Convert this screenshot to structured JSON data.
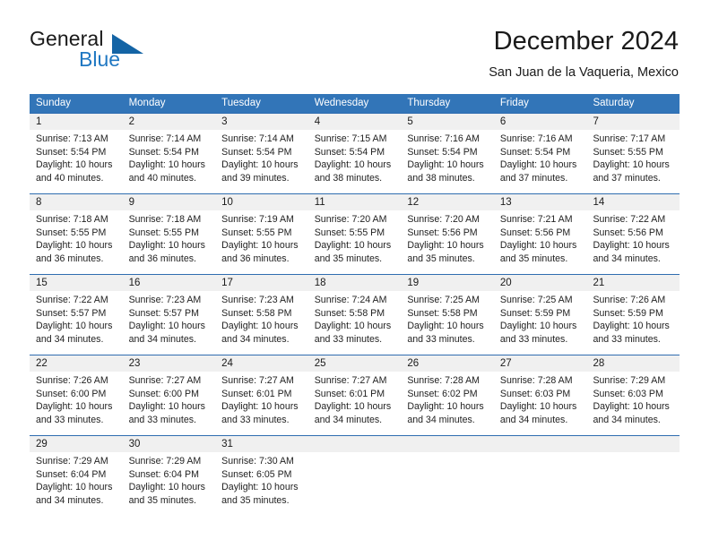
{
  "logo": {
    "word_one": "General",
    "word_two": "Blue",
    "triangle_icon": "blue-triangle-icon",
    "accent_color": "#1464a5",
    "blue_text_color": "#1f77c2"
  },
  "header": {
    "title": "December 2024",
    "subtitle": "San Juan de la Vaqueria, Mexico"
  },
  "theme": {
    "header_band_color": "#3275b8",
    "week_divider_color": "#2f6db0",
    "day_band_color": "#f0f0f0"
  },
  "weekdays": [
    "Sunday",
    "Monday",
    "Tuesday",
    "Wednesday",
    "Thursday",
    "Friday",
    "Saturday"
  ],
  "weeks": [
    [
      {
        "day": "1",
        "sunrise": "Sunrise: 7:13 AM",
        "sunset": "Sunset: 5:54 PM",
        "daylight_line1": "Daylight: 10 hours",
        "daylight_line2": "and 40 minutes."
      },
      {
        "day": "2",
        "sunrise": "Sunrise: 7:14 AM",
        "sunset": "Sunset: 5:54 PM",
        "daylight_line1": "Daylight: 10 hours",
        "daylight_line2": "and 40 minutes."
      },
      {
        "day": "3",
        "sunrise": "Sunrise: 7:14 AM",
        "sunset": "Sunset: 5:54 PM",
        "daylight_line1": "Daylight: 10 hours",
        "daylight_line2": "and 39 minutes."
      },
      {
        "day": "4",
        "sunrise": "Sunrise: 7:15 AM",
        "sunset": "Sunset: 5:54 PM",
        "daylight_line1": "Daylight: 10 hours",
        "daylight_line2": "and 38 minutes."
      },
      {
        "day": "5",
        "sunrise": "Sunrise: 7:16 AM",
        "sunset": "Sunset: 5:54 PM",
        "daylight_line1": "Daylight: 10 hours",
        "daylight_line2": "and 38 minutes."
      },
      {
        "day": "6",
        "sunrise": "Sunrise: 7:16 AM",
        "sunset": "Sunset: 5:54 PM",
        "daylight_line1": "Daylight: 10 hours",
        "daylight_line2": "and 37 minutes."
      },
      {
        "day": "7",
        "sunrise": "Sunrise: 7:17 AM",
        "sunset": "Sunset: 5:55 PM",
        "daylight_line1": "Daylight: 10 hours",
        "daylight_line2": "and 37 minutes."
      }
    ],
    [
      {
        "day": "8",
        "sunrise": "Sunrise: 7:18 AM",
        "sunset": "Sunset: 5:55 PM",
        "daylight_line1": "Daylight: 10 hours",
        "daylight_line2": "and 36 minutes."
      },
      {
        "day": "9",
        "sunrise": "Sunrise: 7:18 AM",
        "sunset": "Sunset: 5:55 PM",
        "daylight_line1": "Daylight: 10 hours",
        "daylight_line2": "and 36 minutes."
      },
      {
        "day": "10",
        "sunrise": "Sunrise: 7:19 AM",
        "sunset": "Sunset: 5:55 PM",
        "daylight_line1": "Daylight: 10 hours",
        "daylight_line2": "and 36 minutes."
      },
      {
        "day": "11",
        "sunrise": "Sunrise: 7:20 AM",
        "sunset": "Sunset: 5:55 PM",
        "daylight_line1": "Daylight: 10 hours",
        "daylight_line2": "and 35 minutes."
      },
      {
        "day": "12",
        "sunrise": "Sunrise: 7:20 AM",
        "sunset": "Sunset: 5:56 PM",
        "daylight_line1": "Daylight: 10 hours",
        "daylight_line2": "and 35 minutes."
      },
      {
        "day": "13",
        "sunrise": "Sunrise: 7:21 AM",
        "sunset": "Sunset: 5:56 PM",
        "daylight_line1": "Daylight: 10 hours",
        "daylight_line2": "and 35 minutes."
      },
      {
        "day": "14",
        "sunrise": "Sunrise: 7:22 AM",
        "sunset": "Sunset: 5:56 PM",
        "daylight_line1": "Daylight: 10 hours",
        "daylight_line2": "and 34 minutes."
      }
    ],
    [
      {
        "day": "15",
        "sunrise": "Sunrise: 7:22 AM",
        "sunset": "Sunset: 5:57 PM",
        "daylight_line1": "Daylight: 10 hours",
        "daylight_line2": "and 34 minutes."
      },
      {
        "day": "16",
        "sunrise": "Sunrise: 7:23 AM",
        "sunset": "Sunset: 5:57 PM",
        "daylight_line1": "Daylight: 10 hours",
        "daylight_line2": "and 34 minutes."
      },
      {
        "day": "17",
        "sunrise": "Sunrise: 7:23 AM",
        "sunset": "Sunset: 5:58 PM",
        "daylight_line1": "Daylight: 10 hours",
        "daylight_line2": "and 34 minutes."
      },
      {
        "day": "18",
        "sunrise": "Sunrise: 7:24 AM",
        "sunset": "Sunset: 5:58 PM",
        "daylight_line1": "Daylight: 10 hours",
        "daylight_line2": "and 33 minutes."
      },
      {
        "day": "19",
        "sunrise": "Sunrise: 7:25 AM",
        "sunset": "Sunset: 5:58 PM",
        "daylight_line1": "Daylight: 10 hours",
        "daylight_line2": "and 33 minutes."
      },
      {
        "day": "20",
        "sunrise": "Sunrise: 7:25 AM",
        "sunset": "Sunset: 5:59 PM",
        "daylight_line1": "Daylight: 10 hours",
        "daylight_line2": "and 33 minutes."
      },
      {
        "day": "21",
        "sunrise": "Sunrise: 7:26 AM",
        "sunset": "Sunset: 5:59 PM",
        "daylight_line1": "Daylight: 10 hours",
        "daylight_line2": "and 33 minutes."
      }
    ],
    [
      {
        "day": "22",
        "sunrise": "Sunrise: 7:26 AM",
        "sunset": "Sunset: 6:00 PM",
        "daylight_line1": "Daylight: 10 hours",
        "daylight_line2": "and 33 minutes."
      },
      {
        "day": "23",
        "sunrise": "Sunrise: 7:27 AM",
        "sunset": "Sunset: 6:00 PM",
        "daylight_line1": "Daylight: 10 hours",
        "daylight_line2": "and 33 minutes."
      },
      {
        "day": "24",
        "sunrise": "Sunrise: 7:27 AM",
        "sunset": "Sunset: 6:01 PM",
        "daylight_line1": "Daylight: 10 hours",
        "daylight_line2": "and 33 minutes."
      },
      {
        "day": "25",
        "sunrise": "Sunrise: 7:27 AM",
        "sunset": "Sunset: 6:01 PM",
        "daylight_line1": "Daylight: 10 hours",
        "daylight_line2": "and 34 minutes."
      },
      {
        "day": "26",
        "sunrise": "Sunrise: 7:28 AM",
        "sunset": "Sunset: 6:02 PM",
        "daylight_line1": "Daylight: 10 hours",
        "daylight_line2": "and 34 minutes."
      },
      {
        "day": "27",
        "sunrise": "Sunrise: 7:28 AM",
        "sunset": "Sunset: 6:03 PM",
        "daylight_line1": "Daylight: 10 hours",
        "daylight_line2": "and 34 minutes."
      },
      {
        "day": "28",
        "sunrise": "Sunrise: 7:29 AM",
        "sunset": "Sunset: 6:03 PM",
        "daylight_line1": "Daylight: 10 hours",
        "daylight_line2": "and 34 minutes."
      }
    ],
    [
      {
        "day": "29",
        "sunrise": "Sunrise: 7:29 AM",
        "sunset": "Sunset: 6:04 PM",
        "daylight_line1": "Daylight: 10 hours",
        "daylight_line2": "and 34 minutes."
      },
      {
        "day": "30",
        "sunrise": "Sunrise: 7:29 AM",
        "sunset": "Sunset: 6:04 PM",
        "daylight_line1": "Daylight: 10 hours",
        "daylight_line2": "and 35 minutes."
      },
      {
        "day": "31",
        "sunrise": "Sunrise: 7:30 AM",
        "sunset": "Sunset: 6:05 PM",
        "daylight_line1": "Daylight: 10 hours",
        "daylight_line2": "and 35 minutes."
      },
      {
        "day": "",
        "sunrise": "",
        "sunset": "",
        "daylight_line1": "",
        "daylight_line2": ""
      },
      {
        "day": "",
        "sunrise": "",
        "sunset": "",
        "daylight_line1": "",
        "daylight_line2": ""
      },
      {
        "day": "",
        "sunrise": "",
        "sunset": "",
        "daylight_line1": "",
        "daylight_line2": ""
      },
      {
        "day": "",
        "sunrise": "",
        "sunset": "",
        "daylight_line1": "",
        "daylight_line2": ""
      }
    ]
  ]
}
